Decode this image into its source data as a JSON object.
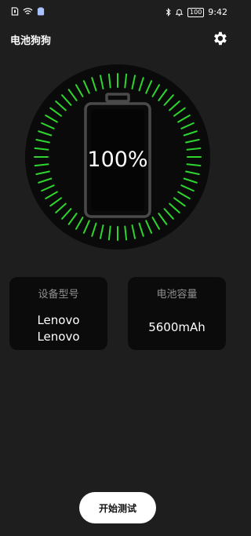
{
  "status_bar": {
    "time": "9:42",
    "battery_level": "100",
    "left_icons": [
      "sim-icon",
      "wifi-icon",
      "notification-icon"
    ],
    "right_icons": [
      "bluetooth-icon",
      "alarm-icon",
      "battery-icon"
    ]
  },
  "header": {
    "title": "电池狗狗",
    "settings_icon": "gear-icon"
  },
  "gauge": {
    "percent_text": "100%",
    "level": 1.0,
    "tick_color": "#2fd52f",
    "battery_outline_color": "#4a4a4a"
  },
  "cards": {
    "device": {
      "label": "设备型号",
      "value_line1": "Lenovo",
      "value_line2": "Lenovo"
    },
    "capacity": {
      "label": "电池容量",
      "value": "5600mAh"
    }
  },
  "actions": {
    "start_label": "开始测试"
  }
}
